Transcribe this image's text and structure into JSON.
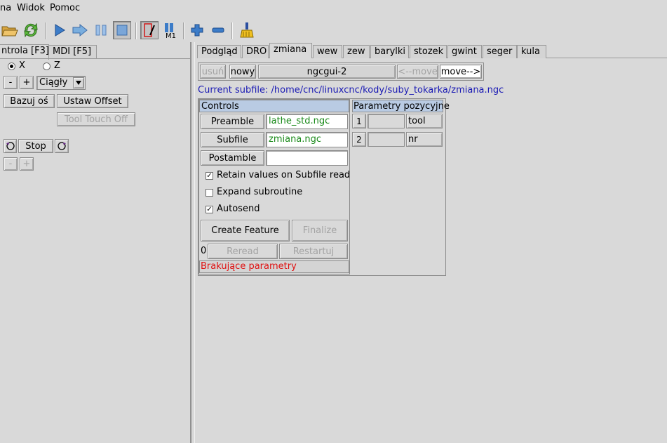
{
  "menu": {
    "items": [
      "na",
      "Widok",
      "Pomoc"
    ]
  },
  "toolbar": {
    "icons": [
      "open-file",
      "reload",
      "run",
      "step",
      "pause",
      "stop",
      "block-delete",
      "optional-stop",
      "zoom-in",
      "zoom-out",
      "clear-plot"
    ]
  },
  "left": {
    "tabs": [
      "ntrola [F3]",
      "MDI [F5]"
    ],
    "axis_x_label": "X",
    "axis_z_label": "Z",
    "minus_label": "-",
    "plus_label": "+",
    "jog_mode": "Ciągły",
    "home_axis_label": "Bazuj oś",
    "set_offset_label": "Ustaw Offset",
    "tool_touch_off_label": "Tool Touch Off",
    "spindle_stop_label": "Stop",
    "spindle_minus_label": "-",
    "spindle_plus_label": "+"
  },
  "right": {
    "tabs": [
      "Podgląd",
      "DRO",
      "zmiana",
      "wew",
      "zew",
      "barylki",
      "stozek",
      "gwint",
      "seger",
      "kula"
    ],
    "active_tab": "zmiana",
    "nav": {
      "remove_label": "usuń",
      "new_label": "nowy",
      "page_title": "ngcgui-2",
      "move_left_label": "<--move",
      "move_right_label": "move-->"
    },
    "current_subfile": "Current subfile: /home/cnc/linuxcnc/kody/suby_tokarka/zmiana.ngc",
    "controls": {
      "header": "Controls",
      "preamble_label": "Preamble",
      "preamble_value": "lathe_std.ngc",
      "subfile_label": "Subfile",
      "subfile_value": "zmiana.ngc",
      "postamble_label": "Postamble",
      "postamble_value": "",
      "retain_label": "Retain values on Subfile read",
      "retain_checked": true,
      "expand_label": "Expand subroutine",
      "expand_checked": false,
      "autosend_label": "Autosend",
      "autosend_checked": true,
      "create_feature_label": "Create Feature",
      "finalize_label": "Finalize",
      "count": "0",
      "reread_label": "Reread",
      "restart_label": "Restartuj",
      "status_message": "Brakujące parametry",
      "status_color": "#e01010"
    },
    "params": {
      "header": "Parametry pozycyjne",
      "rows": [
        {
          "num": "1",
          "value": "",
          "name": "tool"
        },
        {
          "num": "2",
          "value": "",
          "name": "nr"
        }
      ]
    }
  }
}
